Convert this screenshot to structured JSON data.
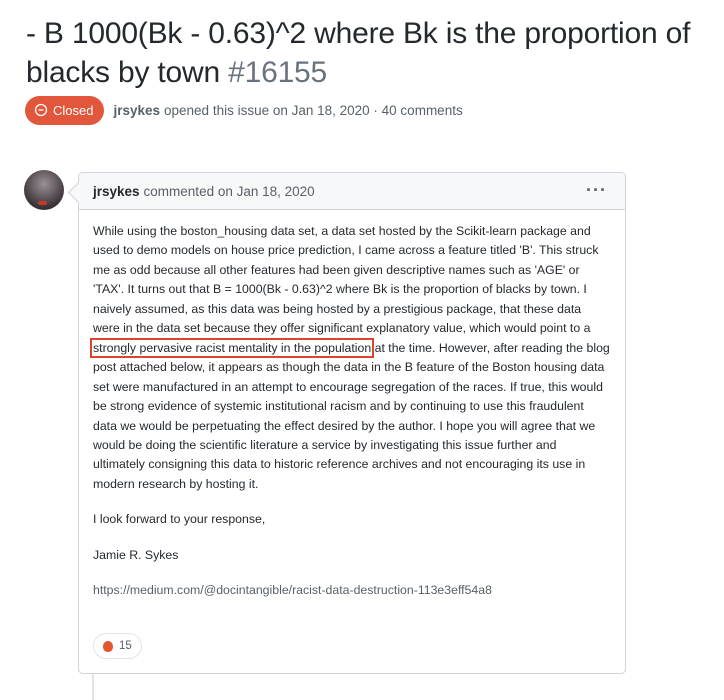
{
  "issue": {
    "title": "- B 1000(Bk - 0.63)^2 where Bk is the proportion of blacks by town",
    "number": "#16155",
    "status": "Closed",
    "status_color": "#e2563c",
    "author": "jrsykes",
    "opened_text": "opened this issue on Jan 18, 2020 · 40 comments"
  },
  "comment": {
    "author": "jrsykes",
    "commented_text": "commented on Jan 18, 2020",
    "menu_icon": "kebab-horizontal-icon",
    "para1_part1": "While using the boston_housing data set, a data set hosted by the Scikit-learn package and used to demo models on house price prediction, I came across a feature titled 'B'. This struck me as odd because all other features had been given descriptive names such as 'AGE' or 'TAX'. It turns out that B = 1000(Bk - 0.63)^2 where Bk is the proportion of blacks by town. I naively assumed, as this data was being hosted by a prestigious package, that these data were in the data set because they offer significant explanatory value, which would point to a",
    "para1_highlight": "strongly pervasive racist mentality in the population",
    "para1_part2": "at the time. However, after reading the blog post attached below, it appears as though the data in the B feature of the Boston housing data set were manufactured in an attempt to encourage segregation of the races. If true, this would be strong evidence of systemic institutional racism and by continuing to use this fraudulent data we would be perpetuating the effect desired by the author. I hope you will agree that we would be doing the scientific literature a service by investigating this issue further and ultimately consigning this data to historic reference archives and not encouraging its use in modern research by hosting it.",
    "para2": "I look forward to your response,",
    "signature": "Jamie R. Sykes",
    "link": "https://medium.com/@docintangible/racist-data-destruction-113e3eff54a8",
    "highlight_color": "#d9452e"
  },
  "reaction": {
    "icon": "thumbs-down-icon",
    "count": "15"
  }
}
